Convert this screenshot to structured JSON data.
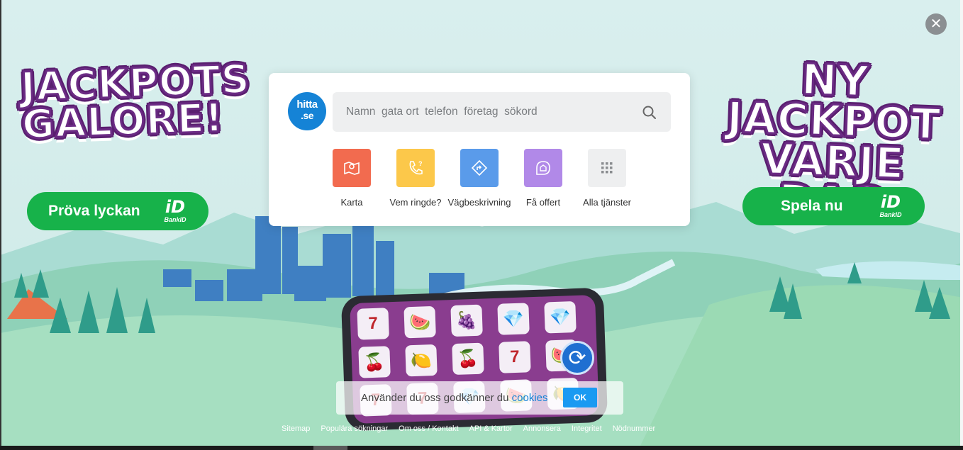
{
  "close": {
    "label": "✕"
  },
  "promo_left": {
    "headline_line1": "JACKPOTS",
    "headline_line2": "GALORE!",
    "button_label": "Pröva lyckan",
    "bankid_label": "BankID"
  },
  "promo_right": {
    "headline_line1": "NY JACKPOT",
    "headline_line2": "VARJE DAG",
    "button_label": "Spela nu",
    "bankid_label": "BankID"
  },
  "search": {
    "logo_line1": "hitta",
    "logo_line2": ".se",
    "placeholder": "Namn  gata ort  telefon  företag  sökord"
  },
  "services": [
    {
      "label": "Karta",
      "color": "#f26b4f",
      "icon": "map-icon"
    },
    {
      "label": "Vem ringde?",
      "color": "#fcc84a",
      "icon": "phone-question-icon"
    },
    {
      "label": "Vägbeskrivning",
      "color": "#5a9bea",
      "icon": "directions-icon"
    },
    {
      "label": "Få offert",
      "color": "#b189e8",
      "icon": "house-chat-icon"
    },
    {
      "label": "Alla tjänster",
      "color": "#eeeff0",
      "icon": "grid-icon"
    }
  ],
  "slot_symbols": [
    [
      "7",
      "🍒",
      "7"
    ],
    [
      "🍉",
      "🍋",
      "7"
    ],
    [
      "🍇",
      "🍒",
      "💎"
    ],
    [
      "💎",
      "7",
      "🍉"
    ],
    [
      "💎",
      "🍉",
      "🍋"
    ]
  ],
  "cookie": {
    "text": "Använder du oss godkänner du",
    "link": "cookies",
    "ok_label": "OK"
  },
  "footer_links": [
    "Sitemap",
    "Populära sökningar",
    "Om oss / Kontakt",
    "API & Kartor",
    "Annonsera",
    "Integritet",
    "Nödnummer"
  ]
}
